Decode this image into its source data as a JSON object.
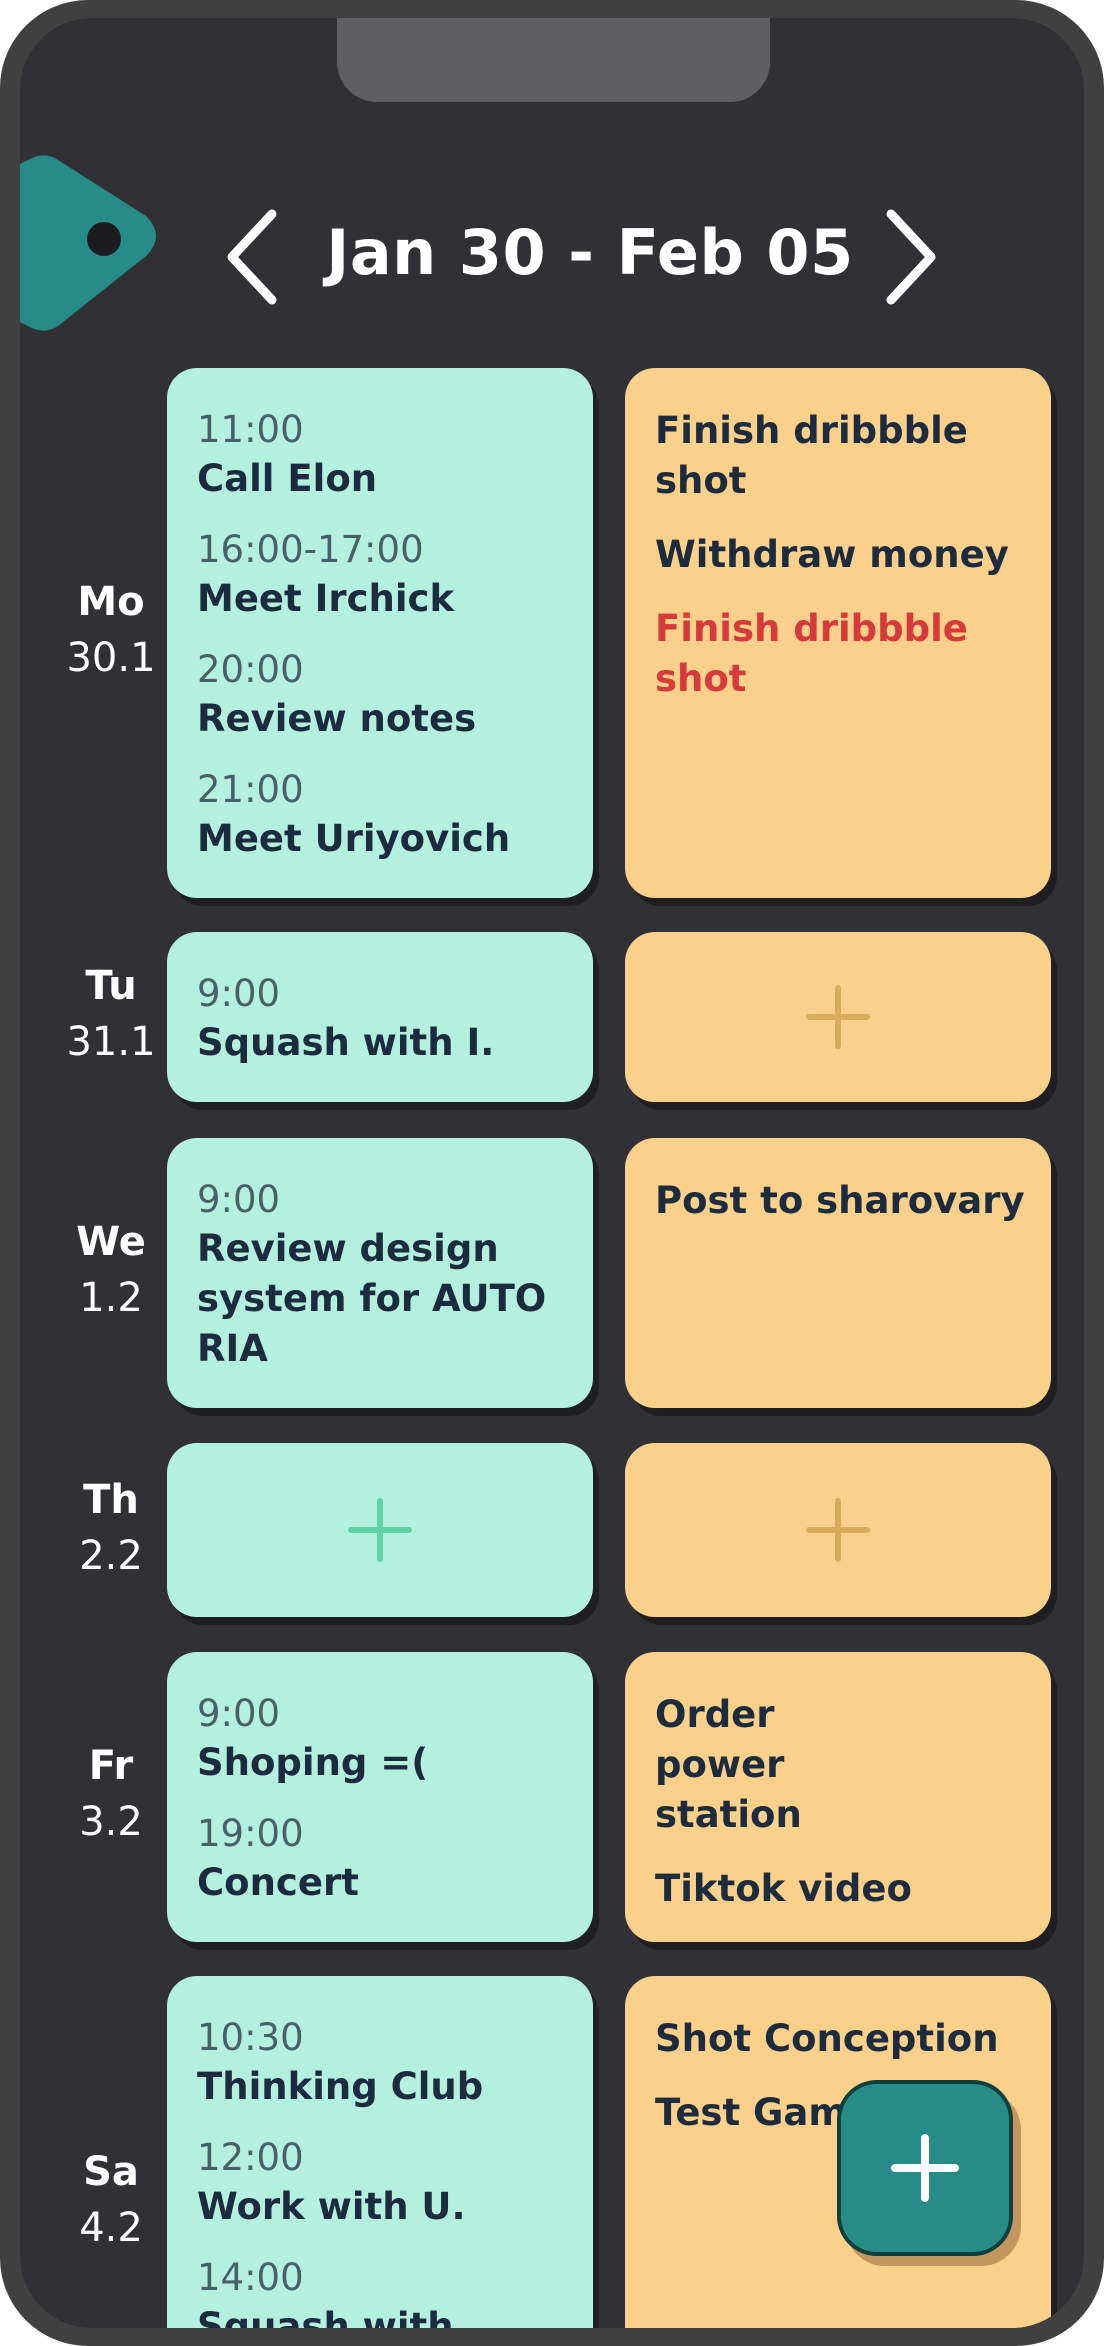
{
  "header": {
    "title": "Jan 30 - Feb 05"
  },
  "days": [
    {
      "name": "Mo",
      "date": "30.1"
    },
    {
      "name": "Tu",
      "date": "31.1"
    },
    {
      "name": "We",
      "date": "1.2"
    },
    {
      "name": "Th",
      "date": "2.2"
    },
    {
      "name": "Fr",
      "date": "3.2"
    },
    {
      "name": "Sa",
      "date": "4.2"
    }
  ],
  "events": {
    "mo": [
      {
        "time": "11:00",
        "title": "Call Elon"
      },
      {
        "time": "16:00-17:00",
        "title": "Meet Irchick"
      },
      {
        "time": "20:00",
        "title": "Review notes"
      },
      {
        "time": "21:00",
        "title": "Meet Uriyovich"
      }
    ],
    "tu": [
      {
        "time": "9:00",
        "title": "Squash with I."
      }
    ],
    "we": [
      {
        "time": "9:00",
        "title": "Review design system for AUTO RIA"
      }
    ],
    "fr": [
      {
        "time": "9:00",
        "title": "Shoping =("
      },
      {
        "time": "19:00",
        "title": "Concert"
      }
    ],
    "sa": [
      {
        "time": "10:30",
        "title": "Thinking Club"
      },
      {
        "time": "12:00",
        "title": "Work with U."
      },
      {
        "time": "14:00",
        "title": "Squash with"
      }
    ]
  },
  "tasks": {
    "mo": [
      "Finish dribbble shot",
      "Withdraw money",
      "Finish dribbble shot"
    ],
    "we": [
      "Post to sharovary"
    ],
    "fr": [
      "Order power station",
      "Tiktok video"
    ],
    "sa": [
      "Shot Conception",
      "Test Game"
    ]
  },
  "colors": {
    "background": "#313035",
    "event_card": "#b3f1de",
    "task_card": "#fad08a",
    "accent": "#278b88",
    "overdue_task": "#d63a3a"
  }
}
